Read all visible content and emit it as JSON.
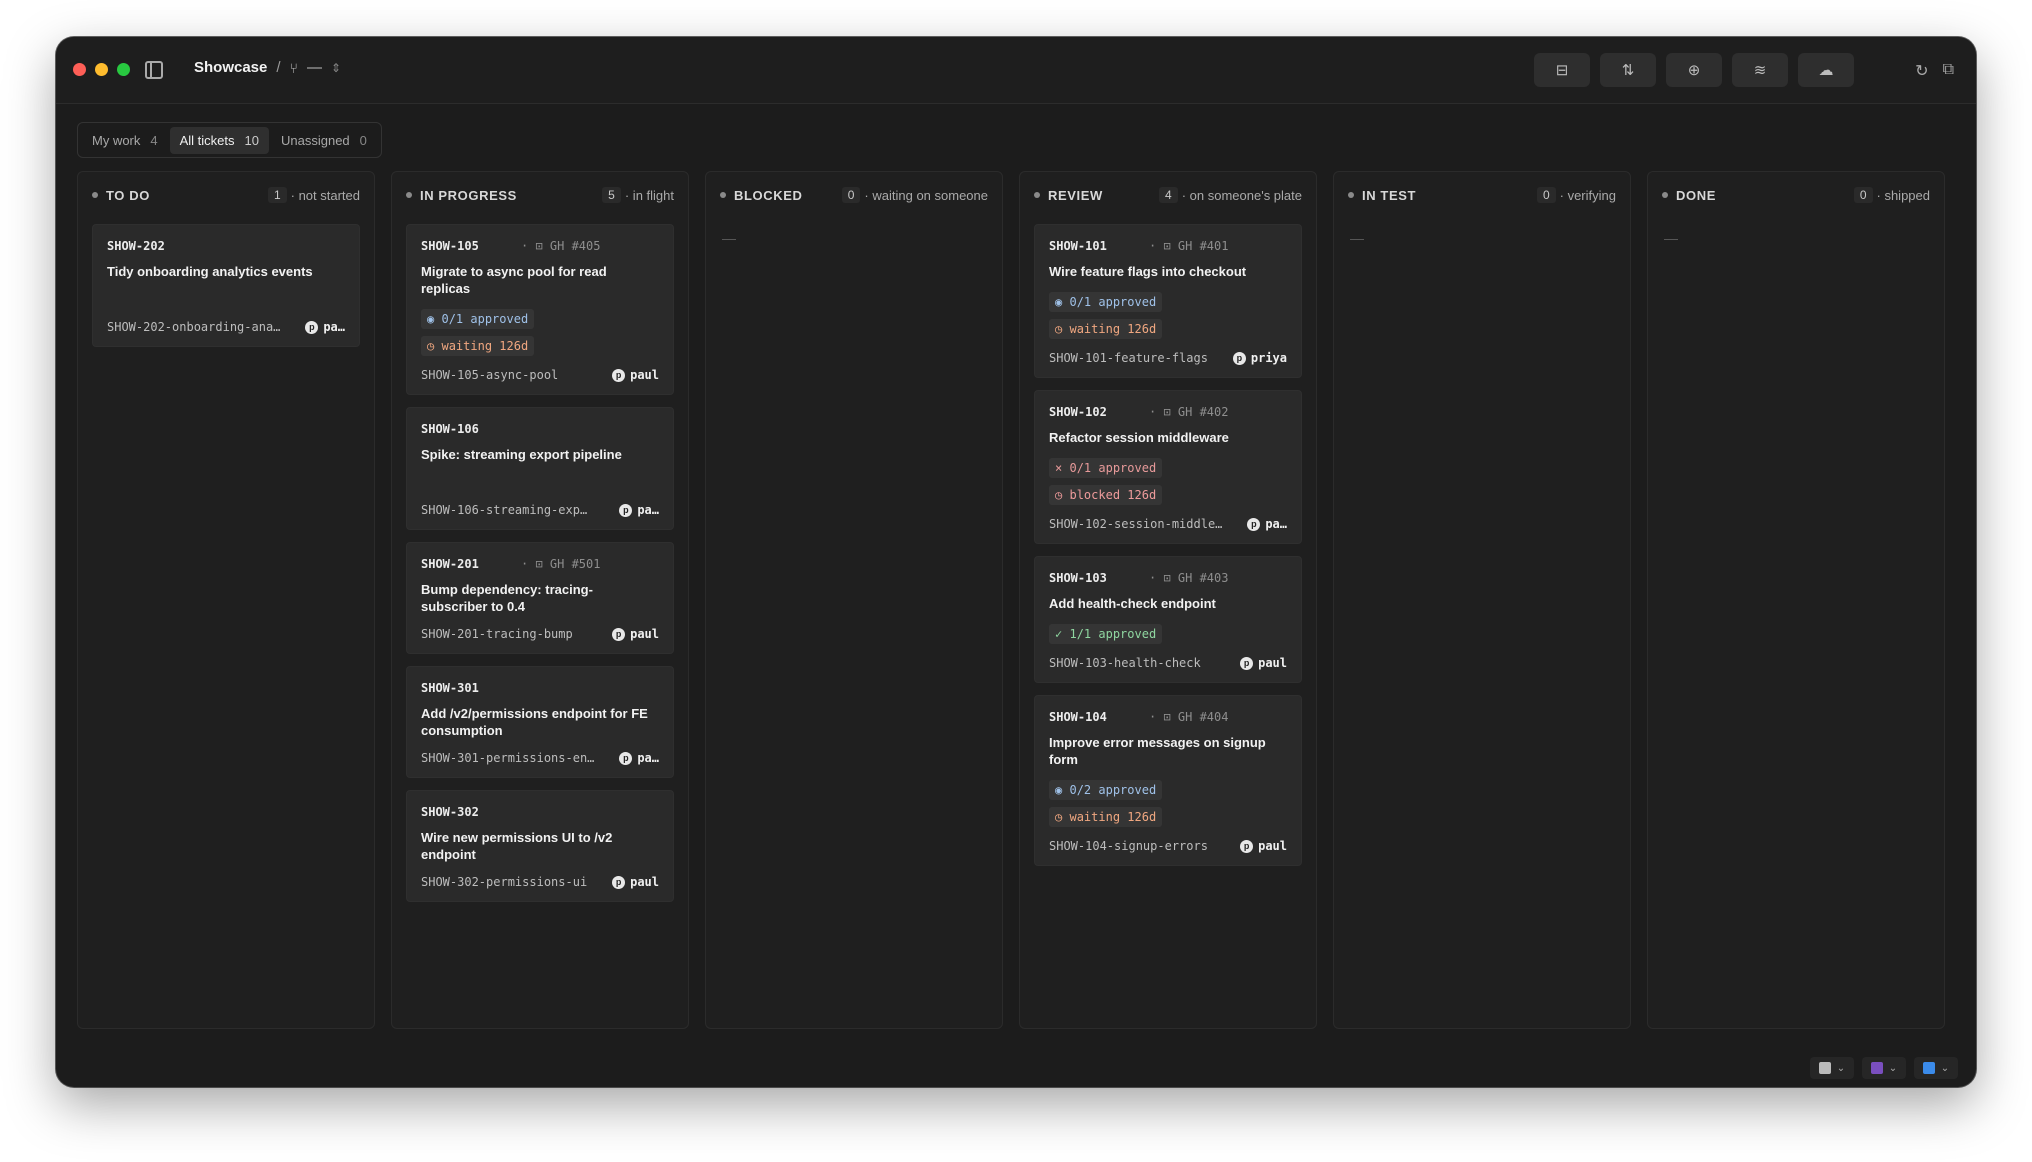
{
  "titlebar": {
    "title": "Showcase",
    "separator": "/",
    "branch": "—",
    "icons": [
      "ticket-icon",
      "pull-request-icon",
      "deploy-icon",
      "stack-icon",
      "cloud-icon"
    ],
    "right_icons": [
      "refresh-icon",
      "open-external-icon"
    ]
  },
  "filters": [
    {
      "label": "My work",
      "count": "4"
    },
    {
      "label": "All tickets",
      "count": "10"
    },
    {
      "label": "Unassigned",
      "count": "0"
    }
  ],
  "columns": [
    {
      "name": "TO DO",
      "count": "1",
      "sub": "· not started",
      "cards": [
        {
          "id": "SHOW-202",
          "gh": "",
          "title": "Tidy onboarding analytics events",
          "tall": true,
          "badges": [],
          "branch": "SHOW-202-onboarding-ana…",
          "assignee": "pa…"
        }
      ]
    },
    {
      "name": "IN PROGRESS",
      "count": "5",
      "sub": "· in flight",
      "cards": [
        {
          "id": "SHOW-105",
          "gh": "· ⊡ GH #405",
          "title": "Migrate to async pool for read replicas",
          "tall": false,
          "badges": [
            {
              "kind": "approved-pending",
              "icon": "◉",
              "text": "0/1 approved"
            },
            {
              "kind": "waiting",
              "icon": "◷",
              "text": "waiting 126d"
            }
          ],
          "branch": "SHOW-105-async-pool",
          "assignee": "paul"
        },
        {
          "id": "SHOW-106",
          "gh": "",
          "title": "Spike: streaming export pipeline",
          "tall": true,
          "badges": [],
          "branch": "SHOW-106-streaming-exp…",
          "assignee": "pa…"
        },
        {
          "id": "SHOW-201",
          "gh": "· ⊡ GH #501",
          "title": "Bump dependency: tracing-subscriber to 0.4",
          "tall": false,
          "badges": [],
          "branch": "SHOW-201-tracing-bump",
          "assignee": "paul"
        },
        {
          "id": "SHOW-301",
          "gh": "",
          "title": "Add /v2/permissions endpoint for FE consumption",
          "tall": false,
          "badges": [],
          "branch": "SHOW-301-permissions-en…",
          "assignee": "pa…"
        },
        {
          "id": "SHOW-302",
          "gh": "",
          "title": "Wire new permissions UI to /v2 endpoint",
          "tall": false,
          "badges": [],
          "branch": "SHOW-302-permissions-ui",
          "assignee": "paul"
        }
      ]
    },
    {
      "name": "BLOCKED",
      "count": "0",
      "sub": "· waiting on someone",
      "empty": "—",
      "cards": []
    },
    {
      "name": "REVIEW",
      "count": "4",
      "sub": "· on someone's plate",
      "cards": [
        {
          "id": "SHOW-101",
          "gh": "· ⊡ GH #401",
          "title": "Wire feature flags into checkout",
          "tall": false,
          "badges": [
            {
              "kind": "approved-pending",
              "icon": "◉",
              "text": "0/1 approved"
            },
            {
              "kind": "waiting",
              "icon": "◷",
              "text": "waiting 126d"
            }
          ],
          "branch": "SHOW-101-feature-flags",
          "assignee": "priya"
        },
        {
          "id": "SHOW-102",
          "gh": "· ⊡ GH #402",
          "title": "Refactor session middleware",
          "tall": false,
          "badges": [
            {
              "kind": "approved-fail",
              "icon": "×",
              "text": "0/1 approved"
            },
            {
              "kind": "blocked",
              "icon": "◷",
              "text": "blocked 126d"
            }
          ],
          "branch": "SHOW-102-session-middle…",
          "assignee": "pa…"
        },
        {
          "id": "SHOW-103",
          "gh": "· ⊡ GH #403",
          "title": "Add health-check endpoint",
          "tall": false,
          "badges": [
            {
              "kind": "approved-ok",
              "icon": "✓",
              "text": "1/1 approved"
            }
          ],
          "branch": "SHOW-103-health-check",
          "assignee": "paul"
        },
        {
          "id": "SHOW-104",
          "gh": "· ⊡ GH #404",
          "title": "Improve error messages on signup form",
          "tall": false,
          "badges": [
            {
              "kind": "approved-pending",
              "icon": "◉",
              "text": "0/2 approved"
            },
            {
              "kind": "waiting",
              "icon": "◷",
              "text": "waiting 126d"
            }
          ],
          "branch": "SHOW-104-signup-errors",
          "assignee": "paul"
        }
      ]
    },
    {
      "name": "IN TEST",
      "count": "0",
      "sub": "· verifying",
      "empty": "—",
      "cards": []
    },
    {
      "name": "DONE",
      "count": "0",
      "sub": "· shipped",
      "empty": "—",
      "cards": []
    }
  ],
  "status_bar": {
    "chips": [
      {
        "name": "editor-icon",
        "color": "#bbbbbb"
      },
      {
        "name": "app-icon",
        "color": "#7a4fbf"
      },
      {
        "name": "finder-icon",
        "color": "#3b8bea"
      }
    ]
  }
}
